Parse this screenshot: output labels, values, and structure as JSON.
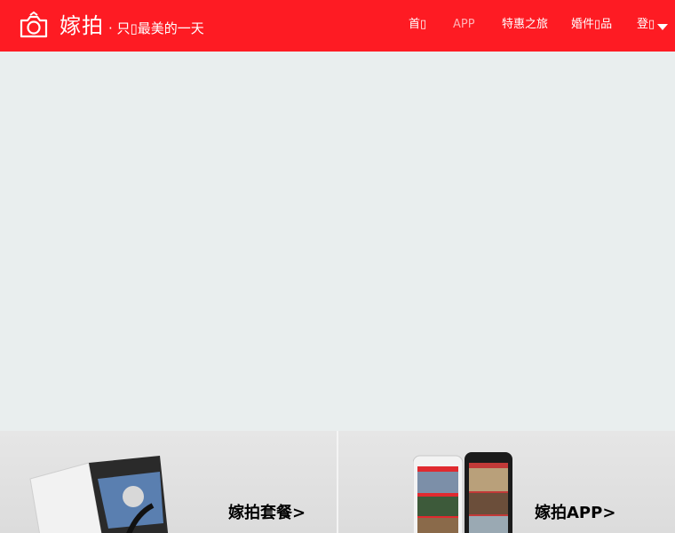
{
  "header": {
    "brand": "嫁拍",
    "tagline": "· 只▯最美的一天",
    "colors": {
      "bar": "#fe1b23",
      "text": "#ffffff"
    }
  },
  "nav": {
    "home": "首▯",
    "app": "APP",
    "travel": "特惠之旅",
    "goods": "婚件▯品",
    "login": "登▯"
  },
  "promos": {
    "package_label": "嫁拍套餐>",
    "app_label": "嫁拍APP>"
  },
  "icons": {
    "logo": "camera-ring-icon",
    "caret": "caret-down-icon"
  }
}
